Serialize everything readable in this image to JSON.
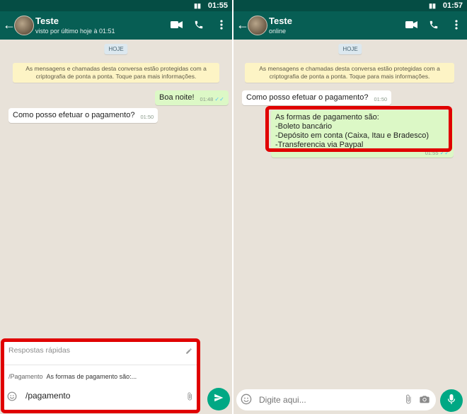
{
  "colors": {
    "header": "#075e54",
    "statusbar": "#054d44",
    "outgoing": "#dcf8c6",
    "incoming": "#ffffff",
    "highlight": "#e00000",
    "accent": "#00a884",
    "wallpaper": "#e8e2d9"
  },
  "left": {
    "status_time": "01:55",
    "contact_name": "Teste",
    "contact_status": "visto por último hoje à 01:51",
    "date_label": "HOJE",
    "encryption_notice": "As mensagens e chamadas desta conversa estão protegidas com a criptografia de ponta a ponta. Toque para mais informações.",
    "messages": [
      {
        "dir": "out",
        "text": "Boa noite!",
        "time": "01:48"
      },
      {
        "dir": "in",
        "text": "Como posso efetuar o pagamento?",
        "time": "01:50"
      }
    ],
    "quick_replies": {
      "title": "Respostas rápidas",
      "items": [
        {
          "shortcut": "/Pagamento",
          "preview": "As formas de pagamento são:..."
        }
      ],
      "input_value": "/pagamento"
    }
  },
  "right": {
    "status_time": "01:57",
    "contact_name": "Teste",
    "contact_status": "online",
    "date_label": "HOJE",
    "encryption_notice": "As mensagens e chamadas desta conversa estão protegidas com a criptografia de ponta a ponta. Toque para mais informações.",
    "messages": [
      {
        "dir": "in",
        "text": "Como posso efetuar o pagamento?",
        "time": "01:50"
      },
      {
        "dir": "out",
        "text": "As formas de pagamento são:\n-Boleto bancário\n-Depósito em conta (Caixa, Itau e Bradesco)\n-Transferencia via Paypal",
        "time": "01:55"
      }
    ],
    "composer_placeholder": "Digite aqui..."
  },
  "icons": [
    "back-arrow-icon",
    "avatar",
    "video-call-icon",
    "phone-icon",
    "more-vert-icon",
    "emoji-icon",
    "attach-icon",
    "camera-icon",
    "mic-icon",
    "send-icon",
    "pencil-icon"
  ]
}
